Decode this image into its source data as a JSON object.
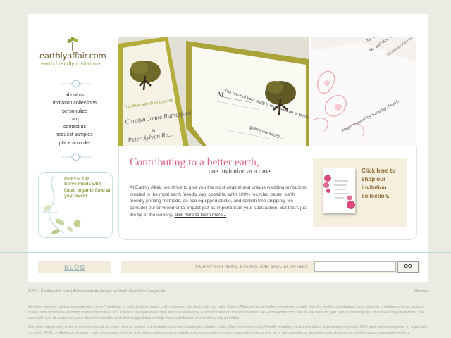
{
  "logo": {
    "name": "earthlyaffair.com",
    "tagline": "earth friendly invitations"
  },
  "nav": [
    "about us",
    "invitation collections",
    "personalize",
    "f.a.q.",
    "contact us",
    "request samples",
    "place an order"
  ],
  "green_tip": {
    "title": "GREEN TIP",
    "text": "Serve meals with local, organic food at your event"
  },
  "photos": {
    "invite_left": [
      "Together with their parents",
      "Carolyn Jamie Rutherford",
      "&",
      "Peter Sylvan Re..."
    ],
    "reply_card": [
      "M",
      "The favor of your reply is requested on or before S...",
      "graciously accep..."
    ],
    "invite_right": [
      "Mr. and Mrs. J...",
      "Mr. and Mrs. Ja...",
      "Alexander Alberto..."
    ],
    "reply_right": "Please respond by Saturday, March"
  },
  "main": {
    "headline": "Contributing to a better earth,",
    "subhead": "one invitation at a time.",
    "body": "At Earthly Affair, we strive to give you the most original and unique wedding invitations created in the most earth friendly way possible. With 100% recycled paper, earth friendly printing methods, an eco equipped studio, and carbon free shipping, we consider our environmental impact just as important as your satisfaction. But that's just the tip of the iceberg,",
    "body_link": "click here to learn more..."
  },
  "promo": {
    "text": "Click here to shop our invitation collection."
  },
  "blog_label": "BLOG",
  "signup": {
    "label": "SIGN UP FOR NEWS, EVENTS, AND SPECIAL OFFERS",
    "input_value": "",
    "button": "GO"
  },
  "footer": {
    "copyright": "©2007 EarthlyAffair.com | Atlanta website design by Mind's Eye Web Design, Inc.",
    "sitemap": "Sitemap",
    "para1": "Whether you are having a completely \"green\" wedding or wish to incorporate only a few eco elements, we can help. EarthlyAffair.com is a leader in environmentally friendly wedding invitations, committed to providing unique, custom-made, and affordable wedding invitations that let you express your personal style and still leave only a tiny footprint on the environment. At EarthlyAffair.com, we do the work for you. When ordering one of our wedding invitations, we work with you to customize your chosen invitation and offer suggestions or help. Your satisfaction is one of our top priorities.",
    "para2": "Our other top priority is the environment and we work hard to ensure our invitations are contributing to a better earth. Our environmentally friendly wedding invitations utilize a premium recycled 100% post consumer paper or a partially recycled, FSC certified cotton paper, both processed chlorine free. Our invitations are created and produced in our eco-equipped studio where all of our operations, as well as our shipping, is offset through renewable energy."
  },
  "colors": {
    "accent_pink": "#e0637e",
    "olive": "#8ea13a",
    "brown": "#8c6a36",
    "rule_blue": "#bcd8dc"
  }
}
